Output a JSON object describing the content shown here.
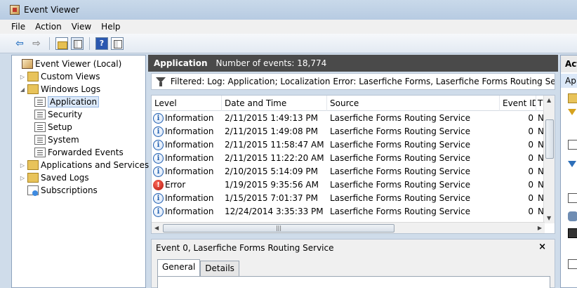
{
  "window": {
    "title": "Event Viewer"
  },
  "menu": [
    "File",
    "Action",
    "View",
    "Help"
  ],
  "tree": {
    "root": "Event Viewer (Local)",
    "custom_views": "Custom Views",
    "windows_logs": "Windows Logs",
    "application": "Application",
    "security": "Security",
    "setup": "Setup",
    "system": "System",
    "forwarded_events": "Forwarded Events",
    "apps_services": "Applications and Services Lo",
    "saved_logs": "Saved Logs",
    "subscriptions": "Subscriptions"
  },
  "log_header": {
    "title": "Application",
    "count": "Number of events: 18,774"
  },
  "filter": {
    "text": "Filtered: Log: Application; Localization Error: Laserfiche Forms, Laserfiche Forms Routing Service."
  },
  "grid": {
    "columns": {
      "level": "Level",
      "date": "Date and Time",
      "source": "Source",
      "event_id": "Event ID",
      "task": "T"
    },
    "rows": [
      {
        "level": "Information",
        "icon": "info-icon",
        "date": "2/11/2015 1:49:13 PM",
        "source": "Laserfiche Forms Routing Service",
        "event_id": "0",
        "task": "N"
      },
      {
        "level": "Information",
        "icon": "info-icon",
        "date": "2/11/2015 1:49:08 PM",
        "source": "Laserfiche Forms Routing Service",
        "event_id": "0",
        "task": "N"
      },
      {
        "level": "Information",
        "icon": "info-icon",
        "date": "2/11/2015 11:58:47 AM",
        "source": "Laserfiche Forms Routing Service",
        "event_id": "0",
        "task": "N"
      },
      {
        "level": "Information",
        "icon": "info-icon",
        "date": "2/11/2015 11:22:20 AM",
        "source": "Laserfiche Forms Routing Service",
        "event_id": "0",
        "task": "N"
      },
      {
        "level": "Information",
        "icon": "info-icon",
        "date": "2/10/2015 5:14:09 PM",
        "source": "Laserfiche Forms Routing Service",
        "event_id": "0",
        "task": "N"
      },
      {
        "level": "Error",
        "icon": "error-icon",
        "date": "1/19/2015 9:35:56 AM",
        "source": "Laserfiche Forms Routing Service",
        "event_id": "0",
        "task": "N"
      },
      {
        "level": "Information",
        "icon": "info-icon",
        "date": "1/15/2015 7:01:37 PM",
        "source": "Laserfiche Forms Routing Service",
        "event_id": "0",
        "task": "N"
      },
      {
        "level": "Information",
        "icon": "info-icon",
        "date": "12/24/2014 3:35:33 PM",
        "source": "Laserfiche Forms Routing Service",
        "event_id": "0",
        "task": "N"
      }
    ]
  },
  "detail": {
    "title": "Event 0, Laserfiche Forms Routing Service",
    "close": "×",
    "tabs": [
      "General",
      "Details"
    ]
  },
  "actions": {
    "header": "Act",
    "sub": "Ap"
  }
}
